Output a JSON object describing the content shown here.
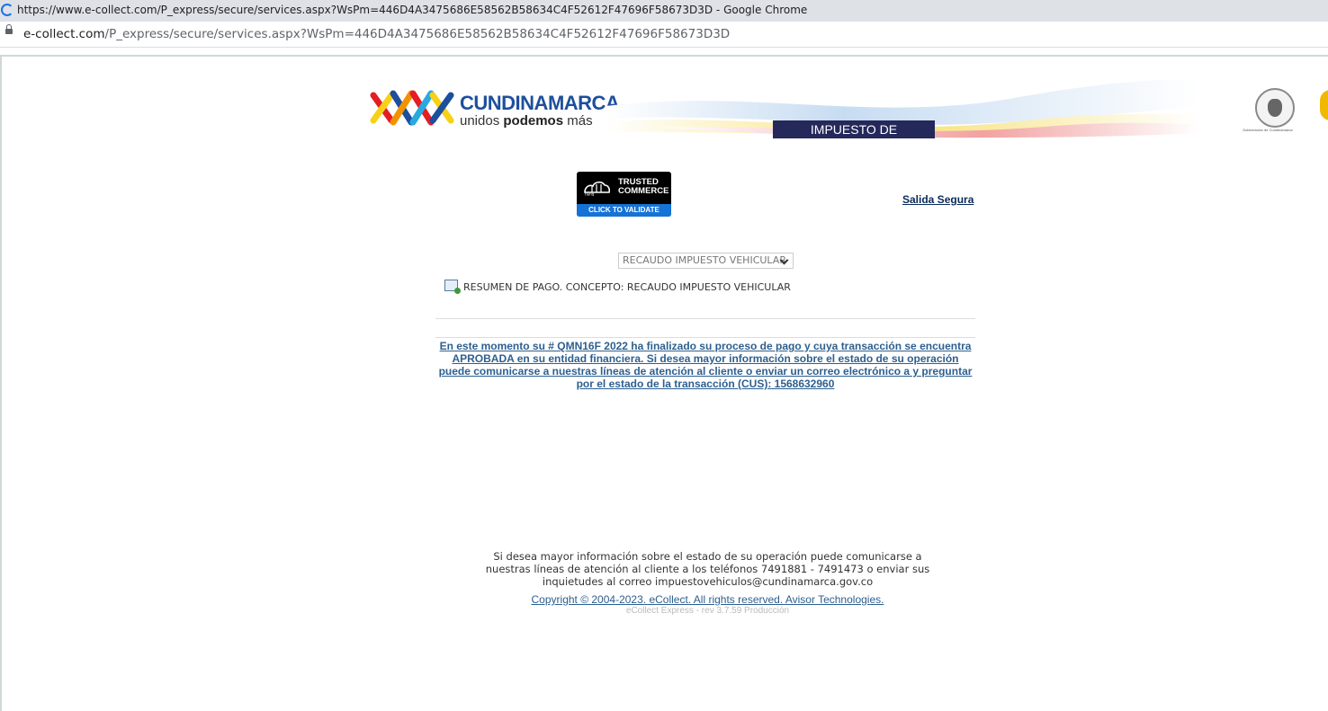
{
  "browser": {
    "window_title": "https://www.e-collect.com/P_express/secure/services.aspx?WsPm=446D4A3475686E58562B58634C4F52612F47696F58673D3D - Google Chrome",
    "url_domain": "e-collect.com",
    "url_path": "/P_express/secure/services.aspx?WsPm=446D4A3475686E58562B58634C4F52612F47696F58673D3D"
  },
  "banner": {
    "brand_name": "CUNDINAMARCA",
    "slogan_pre": "unidos ",
    "slogan_bold": "podemos",
    "slogan_post": " más",
    "band_label": "IMPUESTO DE VEHÍCULOS",
    "seal_caption": "Gobernación de Cundinamarca"
  },
  "trust_badge": {
    "logo_text": "tlang",
    "line1": "TRUSTED",
    "line2": "COMMERCE",
    "cta": "CLICK TO VALIDATE"
  },
  "header": {
    "logout_label": "Salida Segura"
  },
  "service_select": {
    "selected": "RECAUDO IMPUESTO VEHICULAR"
  },
  "summary": {
    "label": "RESUMEN DE PAGO. CONCEPTO: RECAUDO IMPUESTO VEHICULAR"
  },
  "status": {
    "message": "En este momento su # QMN16F 2022 ha finalizado su proceso de pago y cuya transacción se encuentra APROBADA en su entidad financiera. Si desea mayor información sobre el estado de su operación puede comunicarse a nuestras líneas de atención al cliente o enviar un correo electrónico a y preguntar por el estado de la transacción (CUS): 1568632960"
  },
  "footer": {
    "info": "Si desea mayor información sobre el estado de su operación puede comunicarse a nuestras líneas de atención al cliente a los teléfonos 7491881 - 7491473 o enviar sus inquietudes al correo impuestovehiculos@cundinamarca.gov.co",
    "copyright": "Copyright © 2004-2023. eCollect. All rights reserved. Avisor Technologies.",
    "version": "eCollect Express - rev 3.7.59 Producción"
  },
  "colors": {
    "brand_blue": "#1d4f9c",
    "band_navy": "#25285a",
    "link_blue": "#2d5f8f",
    "badge_blue": "#1673d6"
  }
}
